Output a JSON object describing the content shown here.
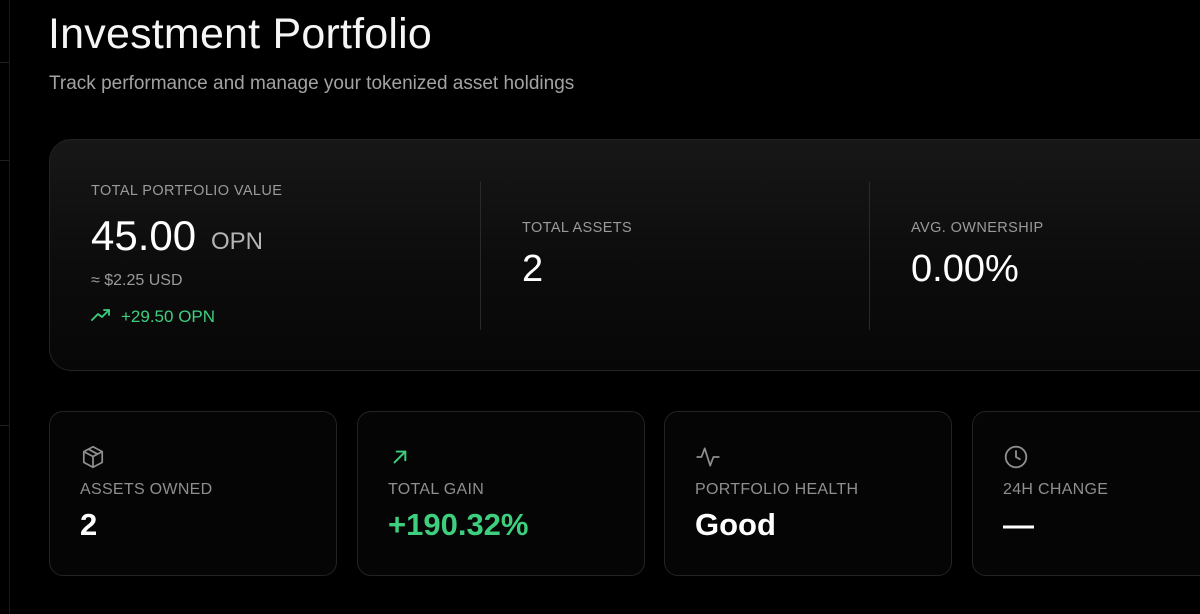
{
  "header": {
    "title": "Investment Portfolio",
    "subtitle": "Track performance and manage your tokenized asset holdings"
  },
  "summary": {
    "total_value": {
      "label": "TOTAL PORTFOLIO VALUE",
      "amount": "45.00",
      "unit": "OPN",
      "usd": "≈ $2.25 USD",
      "change": "+29.50 OPN",
      "change_icon": "trending-up-icon"
    },
    "total_assets": {
      "label": "TOTAL ASSETS",
      "value": "2"
    },
    "avg_ownership": {
      "label": "AVG. OWNERSHIP",
      "value": "0.00%"
    }
  },
  "stats": [
    {
      "icon": "box-icon",
      "label": "ASSETS OWNED",
      "value": "2"
    },
    {
      "icon": "arrow-up-right-icon",
      "label": "TOTAL GAIN",
      "value": "+190.32%"
    },
    {
      "icon": "activity-icon",
      "label": "PORTFOLIO HEALTH",
      "value": "Good"
    },
    {
      "icon": "clock-icon",
      "label": "24H CHANGE",
      "value": "—"
    }
  ],
  "colors": {
    "background": "#000000",
    "positive": "#3ecf7e",
    "muted_text": "#9a9a9a",
    "card_border": "#232323"
  }
}
